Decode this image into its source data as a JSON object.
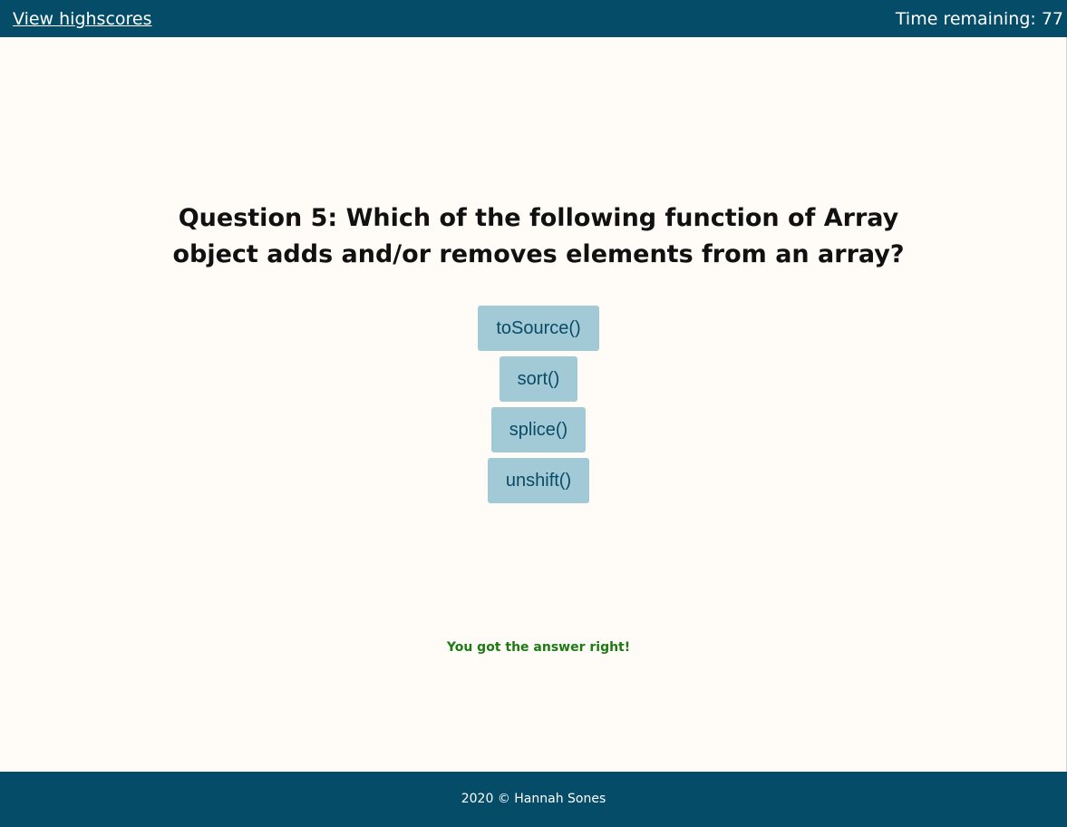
{
  "header": {
    "highscores_link": "View highscores",
    "timer_label": "Time remaining: 77"
  },
  "quiz": {
    "question": "Question 5: Which of the following function of Array object adds and/or removes elements from an array?",
    "answers": [
      "toSource()",
      "sort()",
      "splice()",
      "unshift()"
    ],
    "feedback": "You got the answer right!"
  },
  "footer": {
    "copyright": "2020 © Hannah Sones"
  },
  "colors": {
    "header_bg": "#054c68",
    "page_bg": "#fffcf7",
    "button_bg": "#a2cad6",
    "button_text": "#0b4a66",
    "feedback_text": "#1e7a14"
  }
}
